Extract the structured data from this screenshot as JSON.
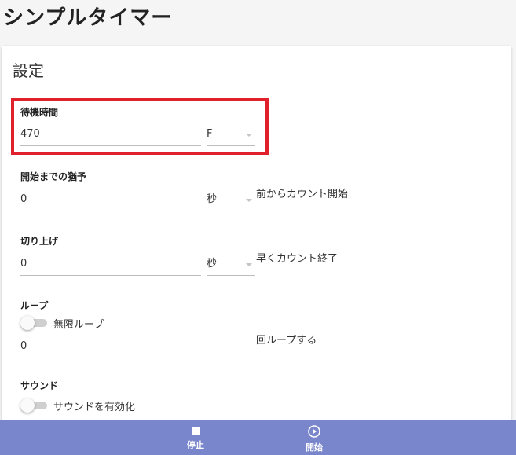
{
  "app": {
    "title": "シンプルタイマー"
  },
  "settings": {
    "title": "設定",
    "wait_time": {
      "label": "待機時間",
      "value": "470",
      "unit": "F"
    },
    "grace": {
      "label": "開始までの猶予",
      "value": "0",
      "unit": "秒",
      "suffix": "前からカウント開始"
    },
    "round_up": {
      "label": "切り上げ",
      "value": "0",
      "unit": "秒",
      "suffix": "早くカウント終了"
    },
    "loop": {
      "label": "ループ",
      "toggle_label": "無限ループ",
      "toggle_on": false,
      "value": "0",
      "suffix": "回ループする"
    },
    "sound": {
      "label": "サウンド",
      "toggle_label": "サウンドを有効化",
      "toggle_on": false
    }
  },
  "bottom_bar": {
    "stop_label": "停止",
    "start_label": "開始",
    "color": "#7986cb"
  },
  "highlight_color": "#e0202b"
}
